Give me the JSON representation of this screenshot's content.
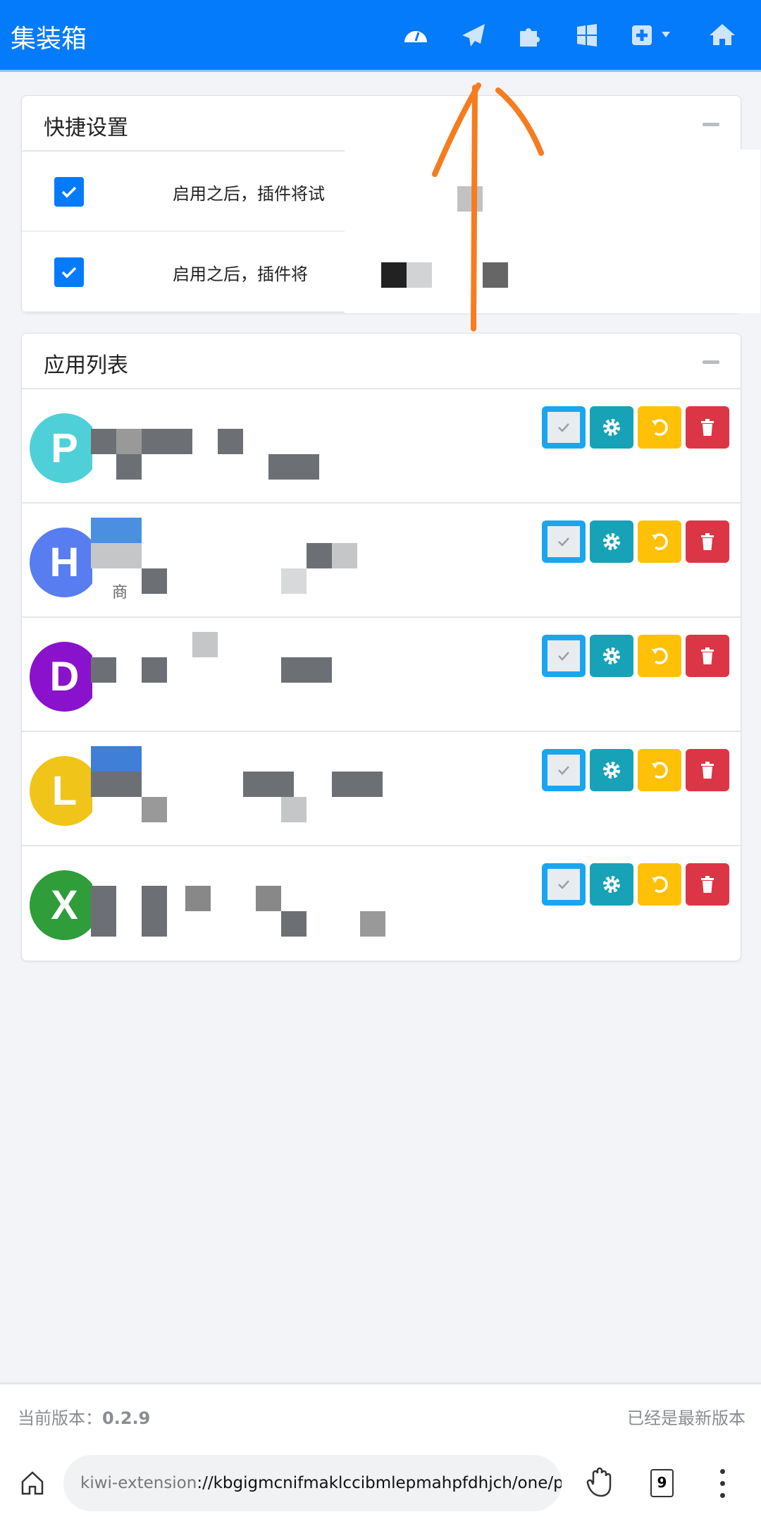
{
  "header": {
    "title": "集装箱",
    "icons": [
      "dashboard-icon",
      "paper-plane-icon",
      "puzzle-icon",
      "windows-icon",
      "plus-square-dropdown-icon",
      "home-icon"
    ]
  },
  "quick_settings": {
    "title": "快捷设置",
    "items": [
      {
        "checked": true,
        "text": "启用之后，插件将试"
      },
      {
        "checked": true,
        "text": "启用之后，插件将"
      }
    ]
  },
  "app_list": {
    "title": "应用列表",
    "apps": [
      {
        "letter": "P",
        "color": "#4fd0d9",
        "subtitle": ""
      },
      {
        "letter": "H",
        "color": "#577df0",
        "subtitle": "商"
      },
      {
        "letter": "D",
        "color": "#8a12cc",
        "subtitle": ""
      },
      {
        "letter": "L",
        "color": "#f0c419",
        "subtitle": ""
      },
      {
        "letter": "X",
        "color": "#2e9d3a",
        "subtitle": ""
      }
    ]
  },
  "footer": {
    "version_label": "当前版本：",
    "version": "0.2.9",
    "status": "已经是最新版本"
  },
  "browser": {
    "url_scheme": "kiwi-extension",
    "url_rest": "://kbgigmcnifmaklccibmlepmahpfdhjch/one/pop",
    "tab_count": "9"
  }
}
